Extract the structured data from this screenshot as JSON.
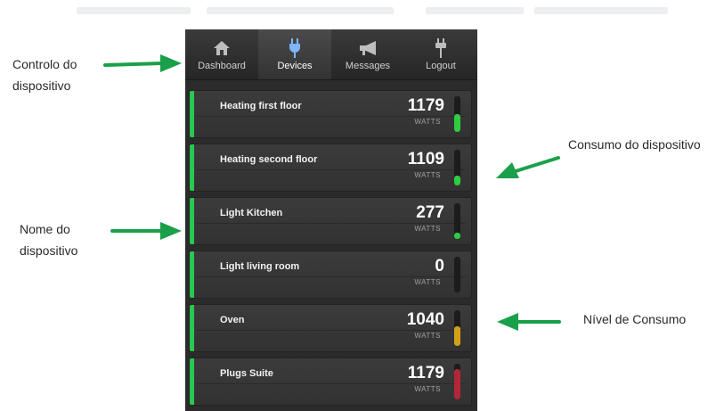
{
  "nav": {
    "tabs": [
      {
        "label": "Dashboard",
        "icon": "home-icon",
        "active": false
      },
      {
        "label": "Devices",
        "icon": "plug-icon",
        "active": true
      },
      {
        "label": "Messages",
        "icon": "megaphone-icon",
        "active": false
      },
      {
        "label": "Logout",
        "icon": "logout-icon",
        "active": false
      }
    ]
  },
  "unit_label": "WATTS",
  "devices": [
    {
      "name": "Heating first floor",
      "value": "1179",
      "level": 0.5,
      "color": "#2ecc40"
    },
    {
      "name": "Heating second floor",
      "value": "1109",
      "level": 0.28,
      "color": "#2ecc40"
    },
    {
      "name": "Light Kitchen",
      "value": "277",
      "level": 0.18,
      "color": "#2ecc40"
    },
    {
      "name": "Light living room",
      "value": "0",
      "level": 0,
      "color": "#2ecc40"
    },
    {
      "name": "Oven",
      "value": "1040",
      "level": 0.55,
      "color": "#d4a017"
    },
    {
      "name": "Plugs Suite",
      "value": "1179",
      "level": 0.85,
      "color": "#b3263a"
    }
  ],
  "annotations": {
    "control": [
      "Controlo do",
      "dispositivo"
    ],
    "consumption": "Consumo do dispositivo",
    "name": [
      "Nome do",
      "dispositivo"
    ],
    "level": "Nível de Consumo"
  },
  "colors": {
    "arrow": "#1aa04a",
    "row_accent": "#28c850"
  }
}
